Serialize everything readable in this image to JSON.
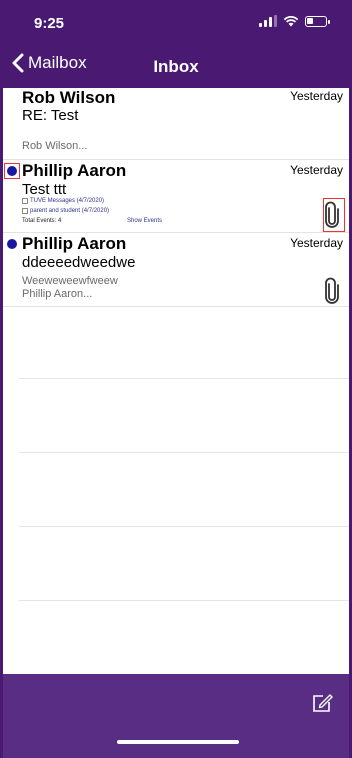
{
  "status_bar": {
    "time": "9:25",
    "signal_icon": "signal-icon",
    "wifi_icon": "wifi-icon",
    "battery_icon": "battery-icon"
  },
  "nav": {
    "back_label": "Mailbox",
    "title": "Inbox"
  },
  "messages": [
    {
      "sender": "Rob Wilson",
      "date": "Yesterday",
      "subject": "RE: Test",
      "preview": "Rob Wilson...",
      "unread": false,
      "attachment": false
    },
    {
      "sender": "Phillip Aaron",
      "date": "Yesterday",
      "subject": "Test ttt",
      "unread": true,
      "attachment": true,
      "details": {
        "item1": "TUVE Messages (4/7/2020)",
        "item2": "parent and student (4/7/2020)",
        "total": "Total Events: 4",
        "show": "Show Events"
      }
    },
    {
      "sender": "Phillip Aaron",
      "date": "Yesterday",
      "subject": "ddeeeedweedwe",
      "preview1": "Weeweweewfweew",
      "preview2": "Phillip Aaron...",
      "unread": true,
      "attachment": true
    }
  ],
  "toolbar": {
    "compose_icon": "compose-icon"
  },
  "colors": {
    "header": "#4a1a72",
    "toolbar": "#5a2d84",
    "unread_dot": "#1a1aa0",
    "highlight": "#ee3333"
  }
}
